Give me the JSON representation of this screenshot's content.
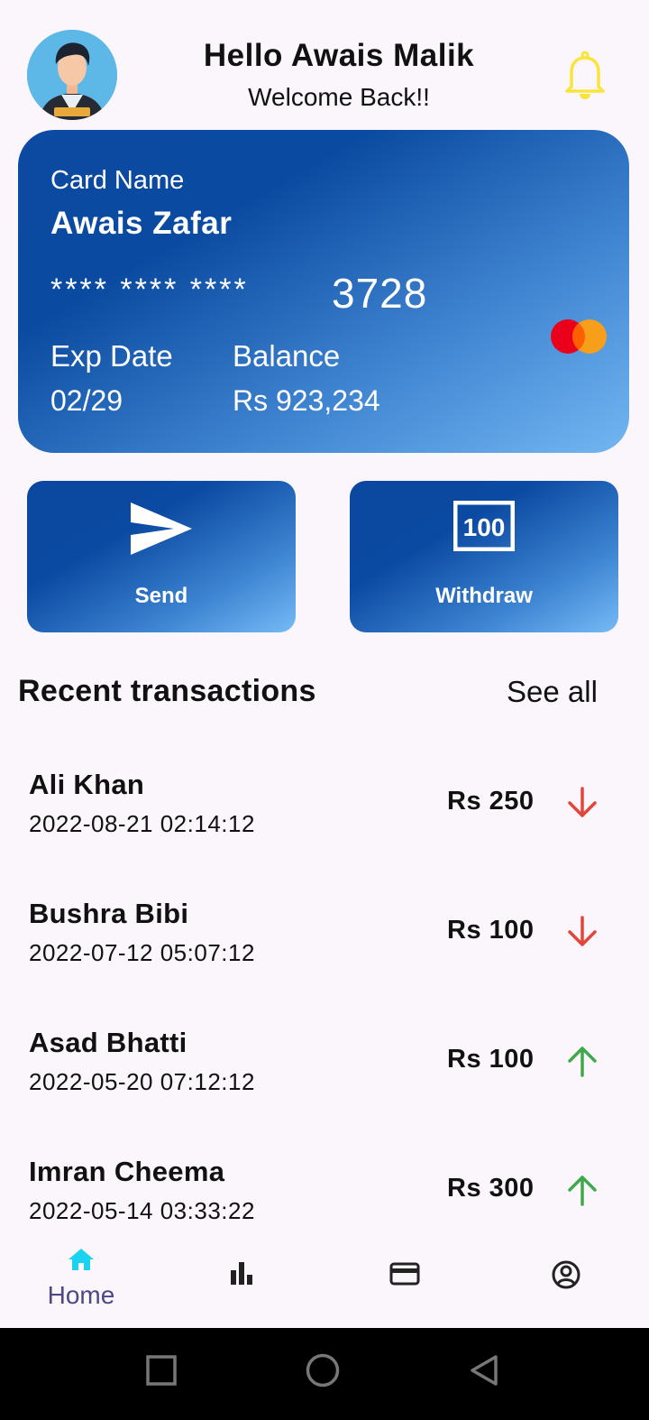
{
  "header": {
    "greeting": "Hello Awais Malik",
    "subtitle": "Welcome Back!!",
    "bell_color": "#f7e53b"
  },
  "card": {
    "name_label": "Card Name",
    "name": "Awais Zafar",
    "masked_number": "**** **** ****",
    "last_digits": "3728",
    "exp_label": "Exp Date",
    "exp_value": "02/29",
    "balance_label": "Balance",
    "balance_value": "Rs 923,234",
    "brand_icon": "mastercard-logo"
  },
  "actions": {
    "send_label": "Send",
    "withdraw_label": "Withdraw",
    "withdraw_icon_text": "100"
  },
  "transactions": {
    "title": "Recent transactions",
    "see_all": "See all",
    "items": [
      {
        "name": "Ali Khan",
        "date": "2022-08-21 02:14:12",
        "amount": "Rs 250",
        "direction": "down"
      },
      {
        "name": "Bushra Bibi",
        "date": "2022-07-12 05:07:12",
        "amount": "Rs 100",
        "direction": "down"
      },
      {
        "name": "Asad Bhatti",
        "date": "2022-05-20 07:12:12",
        "amount": "Rs 100",
        "direction": "up"
      },
      {
        "name": "Imran Cheema",
        "date": "2022-05-14 03:33:22",
        "amount": "Rs 300",
        "direction": "up"
      }
    ]
  },
  "nav": {
    "home_label": "Home",
    "active_color": "#19d3f0",
    "items": [
      "home-icon",
      "bar-chart-icon",
      "credit-card-icon",
      "account-circle-icon"
    ]
  },
  "colors": {
    "arrow_down": "#e2453a",
    "arrow_up": "#3fa84a"
  }
}
